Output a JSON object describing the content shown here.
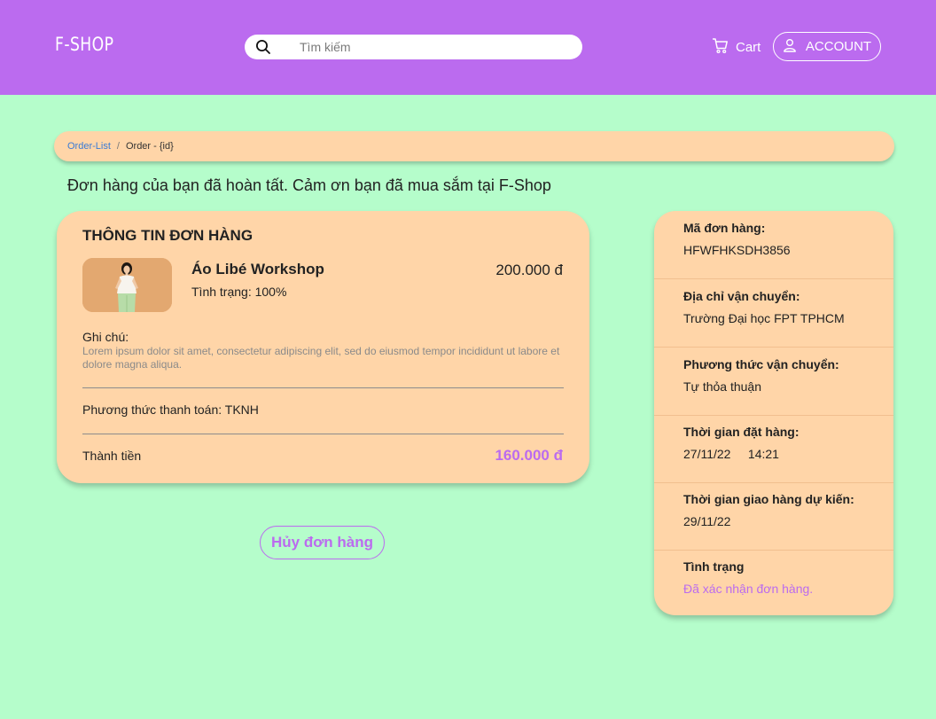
{
  "header": {
    "logo": "F-SHOP",
    "search_placeholder": "Tìm kiếm",
    "cart_label": "Cart",
    "account_label": "ACCOUNT"
  },
  "breadcrumb": {
    "link": "Order-List",
    "separator": "/",
    "current": "Order - {id}"
  },
  "message": "Đơn hàng của bạn đã hoàn tất. Cảm ơn bạn đã mua sắm tại F-Shop",
  "order": {
    "title": "THÔNG TIN ĐƠN HÀNG",
    "product_name": "Áo Libé Workshop",
    "product_status": "Tình trạng: 100%",
    "product_price": "200.000 đ",
    "note_label": "Ghi chú:",
    "note_text": "Lorem ipsum dolor sit amet, consectetur adipiscing elit, sed do eiusmod tempor incididunt ut labore et dolore magna aliqua.",
    "payment": "Phương thức thanh toán: TKNH",
    "total_label": "Thành tiền",
    "total_value": "160.000 đ"
  },
  "cancel_label": "Hủy đơn hàng",
  "info": {
    "rows": [
      {
        "label": "Mã đơn hàng:",
        "value": "HFWFHKSDH3856"
      },
      {
        "label": "Địa chỉ vận chuyển:",
        "value": "Trường Đại học FPT TPHCM"
      },
      {
        "label": "Phương thức vận chuyển:",
        "value": "Tự thỏa thuận"
      },
      {
        "label": "Thời gian đặt hàng:",
        "value": "27/11/22     14:21"
      },
      {
        "label": "Thời gian giao hàng dự kiến:",
        "value": "29/11/22"
      },
      {
        "label": "Tình trạng",
        "value": "Đã xác nhận đơn hàng."
      }
    ]
  },
  "colors": {
    "header": "#bb6bef",
    "background": "#b5fdcb",
    "card": "#ffd5a8",
    "accent": "#bb6bef"
  },
  "icons": {
    "search": "search-icon",
    "cart": "cart-icon",
    "account": "user-icon",
    "product": "product-image"
  }
}
